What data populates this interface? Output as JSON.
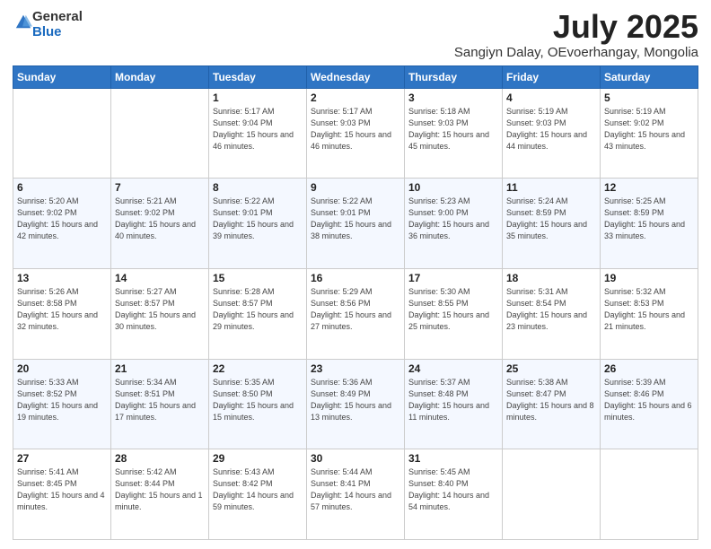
{
  "header": {
    "logo": {
      "general": "General",
      "blue": "Blue"
    },
    "title": "July 2025",
    "location": "Sangiyn Dalay, OEvoerhangay, Mongolia"
  },
  "weekdays": [
    "Sunday",
    "Monday",
    "Tuesday",
    "Wednesday",
    "Thursday",
    "Friday",
    "Saturday"
  ],
  "weeks": [
    [
      {
        "day": "",
        "info": ""
      },
      {
        "day": "",
        "info": ""
      },
      {
        "day": "1",
        "info": "Sunrise: 5:17 AM\nSunset: 9:04 PM\nDaylight: 15 hours and 46 minutes."
      },
      {
        "day": "2",
        "info": "Sunrise: 5:17 AM\nSunset: 9:03 PM\nDaylight: 15 hours and 46 minutes."
      },
      {
        "day": "3",
        "info": "Sunrise: 5:18 AM\nSunset: 9:03 PM\nDaylight: 15 hours and 45 minutes."
      },
      {
        "day": "4",
        "info": "Sunrise: 5:19 AM\nSunset: 9:03 PM\nDaylight: 15 hours and 44 minutes."
      },
      {
        "day": "5",
        "info": "Sunrise: 5:19 AM\nSunset: 9:02 PM\nDaylight: 15 hours and 43 minutes."
      }
    ],
    [
      {
        "day": "6",
        "info": "Sunrise: 5:20 AM\nSunset: 9:02 PM\nDaylight: 15 hours and 42 minutes."
      },
      {
        "day": "7",
        "info": "Sunrise: 5:21 AM\nSunset: 9:02 PM\nDaylight: 15 hours and 40 minutes."
      },
      {
        "day": "8",
        "info": "Sunrise: 5:22 AM\nSunset: 9:01 PM\nDaylight: 15 hours and 39 minutes."
      },
      {
        "day": "9",
        "info": "Sunrise: 5:22 AM\nSunset: 9:01 PM\nDaylight: 15 hours and 38 minutes."
      },
      {
        "day": "10",
        "info": "Sunrise: 5:23 AM\nSunset: 9:00 PM\nDaylight: 15 hours and 36 minutes."
      },
      {
        "day": "11",
        "info": "Sunrise: 5:24 AM\nSunset: 8:59 PM\nDaylight: 15 hours and 35 minutes."
      },
      {
        "day": "12",
        "info": "Sunrise: 5:25 AM\nSunset: 8:59 PM\nDaylight: 15 hours and 33 minutes."
      }
    ],
    [
      {
        "day": "13",
        "info": "Sunrise: 5:26 AM\nSunset: 8:58 PM\nDaylight: 15 hours and 32 minutes."
      },
      {
        "day": "14",
        "info": "Sunrise: 5:27 AM\nSunset: 8:57 PM\nDaylight: 15 hours and 30 minutes."
      },
      {
        "day": "15",
        "info": "Sunrise: 5:28 AM\nSunset: 8:57 PM\nDaylight: 15 hours and 29 minutes."
      },
      {
        "day": "16",
        "info": "Sunrise: 5:29 AM\nSunset: 8:56 PM\nDaylight: 15 hours and 27 minutes."
      },
      {
        "day": "17",
        "info": "Sunrise: 5:30 AM\nSunset: 8:55 PM\nDaylight: 15 hours and 25 minutes."
      },
      {
        "day": "18",
        "info": "Sunrise: 5:31 AM\nSunset: 8:54 PM\nDaylight: 15 hours and 23 minutes."
      },
      {
        "day": "19",
        "info": "Sunrise: 5:32 AM\nSunset: 8:53 PM\nDaylight: 15 hours and 21 minutes."
      }
    ],
    [
      {
        "day": "20",
        "info": "Sunrise: 5:33 AM\nSunset: 8:52 PM\nDaylight: 15 hours and 19 minutes."
      },
      {
        "day": "21",
        "info": "Sunrise: 5:34 AM\nSunset: 8:51 PM\nDaylight: 15 hours and 17 minutes."
      },
      {
        "day": "22",
        "info": "Sunrise: 5:35 AM\nSunset: 8:50 PM\nDaylight: 15 hours and 15 minutes."
      },
      {
        "day": "23",
        "info": "Sunrise: 5:36 AM\nSunset: 8:49 PM\nDaylight: 15 hours and 13 minutes."
      },
      {
        "day": "24",
        "info": "Sunrise: 5:37 AM\nSunset: 8:48 PM\nDaylight: 15 hours and 11 minutes."
      },
      {
        "day": "25",
        "info": "Sunrise: 5:38 AM\nSunset: 8:47 PM\nDaylight: 15 hours and 8 minutes."
      },
      {
        "day": "26",
        "info": "Sunrise: 5:39 AM\nSunset: 8:46 PM\nDaylight: 15 hours and 6 minutes."
      }
    ],
    [
      {
        "day": "27",
        "info": "Sunrise: 5:41 AM\nSunset: 8:45 PM\nDaylight: 15 hours and 4 minutes."
      },
      {
        "day": "28",
        "info": "Sunrise: 5:42 AM\nSunset: 8:44 PM\nDaylight: 15 hours and 1 minute."
      },
      {
        "day": "29",
        "info": "Sunrise: 5:43 AM\nSunset: 8:42 PM\nDaylight: 14 hours and 59 minutes."
      },
      {
        "day": "30",
        "info": "Sunrise: 5:44 AM\nSunset: 8:41 PM\nDaylight: 14 hours and 57 minutes."
      },
      {
        "day": "31",
        "info": "Sunrise: 5:45 AM\nSunset: 8:40 PM\nDaylight: 14 hours and 54 minutes."
      },
      {
        "day": "",
        "info": ""
      },
      {
        "day": "",
        "info": ""
      }
    ]
  ]
}
